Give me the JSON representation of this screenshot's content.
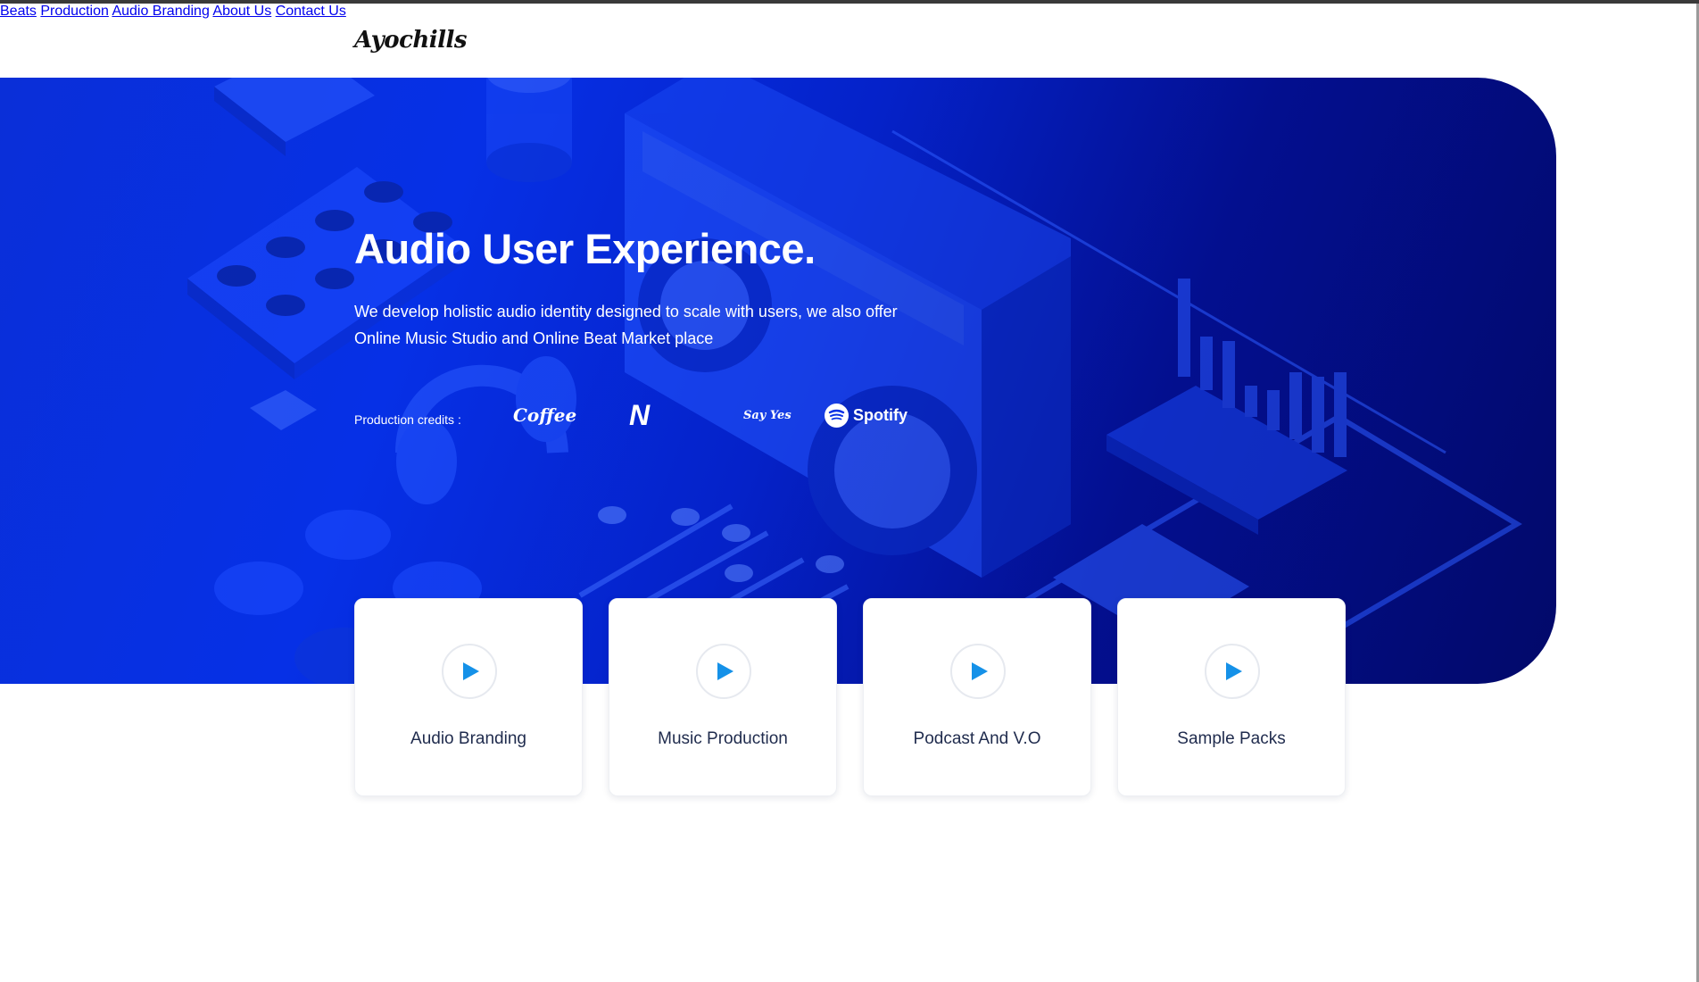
{
  "brand": {
    "logo_text": "Ayochills"
  },
  "nav": {
    "items": [
      {
        "label": "Beats"
      },
      {
        "label": "Production"
      },
      {
        "label": "Audio Branding"
      },
      {
        "label": "About Us"
      },
      {
        "label": "Contact Us"
      }
    ]
  },
  "hero": {
    "title": "Audio User Experience.",
    "subtitle": "We develop holistic audio identity designed to scale with users, we also offer Online Music Studio and Online Beat Market place",
    "credits_label": "Production credits :",
    "credits": [
      {
        "name": "Coffee",
        "icon": "coffee-logo"
      },
      {
        "name": "N",
        "icon": "n-logo"
      },
      {
        "name": "Say Yes",
        "icon": "sayyes-logo"
      },
      {
        "name": "Spotify",
        "icon": "spotify-logo"
      }
    ]
  },
  "services": [
    {
      "label": "Audio Branding",
      "icon": "play-icon"
    },
    {
      "label": "Music Production",
      "icon": "play-icon"
    },
    {
      "label": "Podcast And V.O",
      "icon": "play-icon"
    },
    {
      "label": "Sample Packs",
      "icon": "play-icon"
    }
  ],
  "colors": {
    "hero_blue": "#0630e6",
    "hero_dark": "#02096a",
    "play_accent": "#1591e8",
    "text_dark": "#1f2b4d",
    "nav_text": "#6b6f7b"
  }
}
